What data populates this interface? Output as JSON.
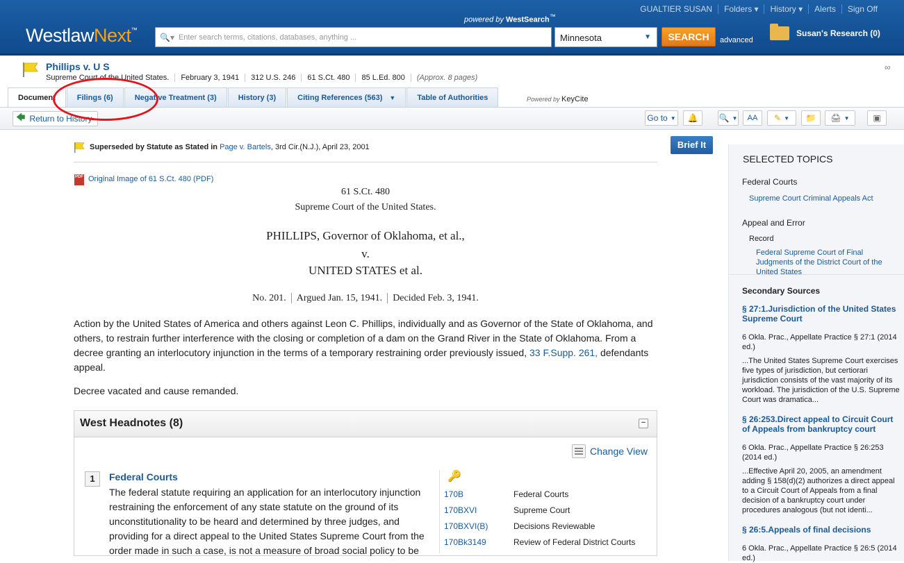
{
  "header": {
    "logo_main": "Westlaw",
    "logo_accent": "Next",
    "logo_tm": "™",
    "powered_by": "powered by",
    "powered_brand": "WestSearch",
    "powered_tm": "™",
    "nav": [
      "GUALTIER SUSAN",
      "Folders ▾",
      "History ▾",
      "Alerts",
      "Sign Off"
    ],
    "search_placeholder": "Enter search terms, citations, databases, anything ...",
    "jurisdiction": "Minnesota",
    "search_button": "SEARCH",
    "advanced": "advanced",
    "research_folder": "Susan's Research (0)"
  },
  "doc": {
    "title": "Phillips v. U S",
    "meta": [
      "Supreme Court of the United States.",
      "February 3, 1941",
      "312 U.S. 246",
      "61 S.Ct. 480",
      "85 L.Ed. 800"
    ],
    "pages": "(Approx. 8 pages)"
  },
  "tabs": [
    {
      "label": "Document"
    },
    {
      "label": "Filings (6)"
    },
    {
      "label": "Negative Treatment (3)"
    },
    {
      "label": "History (3)"
    },
    {
      "label": "Citing References (563)"
    },
    {
      "label": "Table of Authorities"
    }
  ],
  "keycite": {
    "powered": "Powered by",
    "brand": "KeyCite"
  },
  "toolbar": {
    "return": "Return to History",
    "goto": "Go to",
    "aa": "AA"
  },
  "main": {
    "superseded_bold": "Superseded by Statute as Stated in",
    "superseded_link": "Page v. Bartels",
    "superseded_rest": ", 3rd Cir.(N.J.), April 23, 2001",
    "pdf_icon": "PDF",
    "pdf_link": "Original Image of 61 S.Ct. 480 (PDF)",
    "brief_it": "Brief It",
    "cite": "61 S.Ct. 480",
    "court": "Supreme Court of the United States.",
    "party1": "PHILLIPS, Governor of Oklahoma, et al.,",
    "versus": "v.",
    "party2": "UNITED STATES et al.",
    "docket": [
      "No. 201.",
      "Argued Jan. 15, 1941.",
      "Decided Feb. 3, 1941."
    ],
    "synopsis": "Action by the United States of America and others against Leon C. Phillips, individually and as Governor of the State of Oklahoma, and others, to restrain further interference with the closing or completion of a dam on the Grand River in the State of Oklahoma. From a decree granting an interlocutory injunction in the terms of a temporary restraining order previously issued,",
    "synopsis_link": "33 F.Supp. 261,",
    "synopsis_end": "defendants appeal.",
    "decree": "Decree vacated and cause remanded."
  },
  "headnotes": {
    "title": "West Headnotes (8)",
    "change_view": "Change View",
    "num": "1",
    "topic": "Federal Courts",
    "text": "The federal statute requiring an application for an interlocutory injunction restraining the enforcement of any state statute on the ground of its unconstitutionality to be heard and determined by three judges, and providing for a direct appeal to the United States Supreme Court from the order made in such a case, is not a measure of broad social policy to be",
    "keynumbers": [
      {
        "code": "170B",
        "label": "Federal Courts"
      },
      {
        "code": "170BXVI",
        "label": "Supreme Court"
      },
      {
        "code": "170BXVI(B)",
        "label": "Decisions Reviewable"
      },
      {
        "code": "170Bk3149",
        "label": "Review of Federal District Courts"
      }
    ]
  },
  "sidebar": {
    "selected_topics": "SELECTED TOPICS",
    "topic1": "Federal Courts",
    "topic1_link": "Supreme Court Criminal Appeals Act",
    "topic2": "Appeal and Error",
    "topic2_sub": "Record",
    "topic2_link": "Federal Supreme Court of Final Judgments of the District Court of the United States",
    "secondary": "Secondary Sources",
    "sources": [
      {
        "title": "§ 27:1.Jurisdiction of the United States Supreme Court",
        "meta": "6 Okla. Prac., Appellate Practice § 27:1 (2014 ed.)",
        "snippet": "...The United States Supreme Court exercises five types of jurisdiction, but certiorari jurisdiction consists of the vast majority of its workload. The jurisdiction of the U.S. Supreme Court was dramatica..."
      },
      {
        "title": "§ 26:253.Direct appeal to Circuit Court of Appeals from bankruptcy court",
        "meta": "6 Okla. Prac., Appellate Practice § 26:253 (2014 ed.)",
        "snippet": "...Effective April 20, 2005, an amendment adding § 158(d)(2) authorizes a direct appeal to a Circuit Court of Appeals from a final decision of a bankruptcy court under procedures analogous (but not identi..."
      },
      {
        "title": "§ 26:5.Appeals of final decisions",
        "meta": "6 Okla. Prac., Appellate Practice § 26:5 (2014 ed.)",
        "snippet": ""
      }
    ]
  }
}
